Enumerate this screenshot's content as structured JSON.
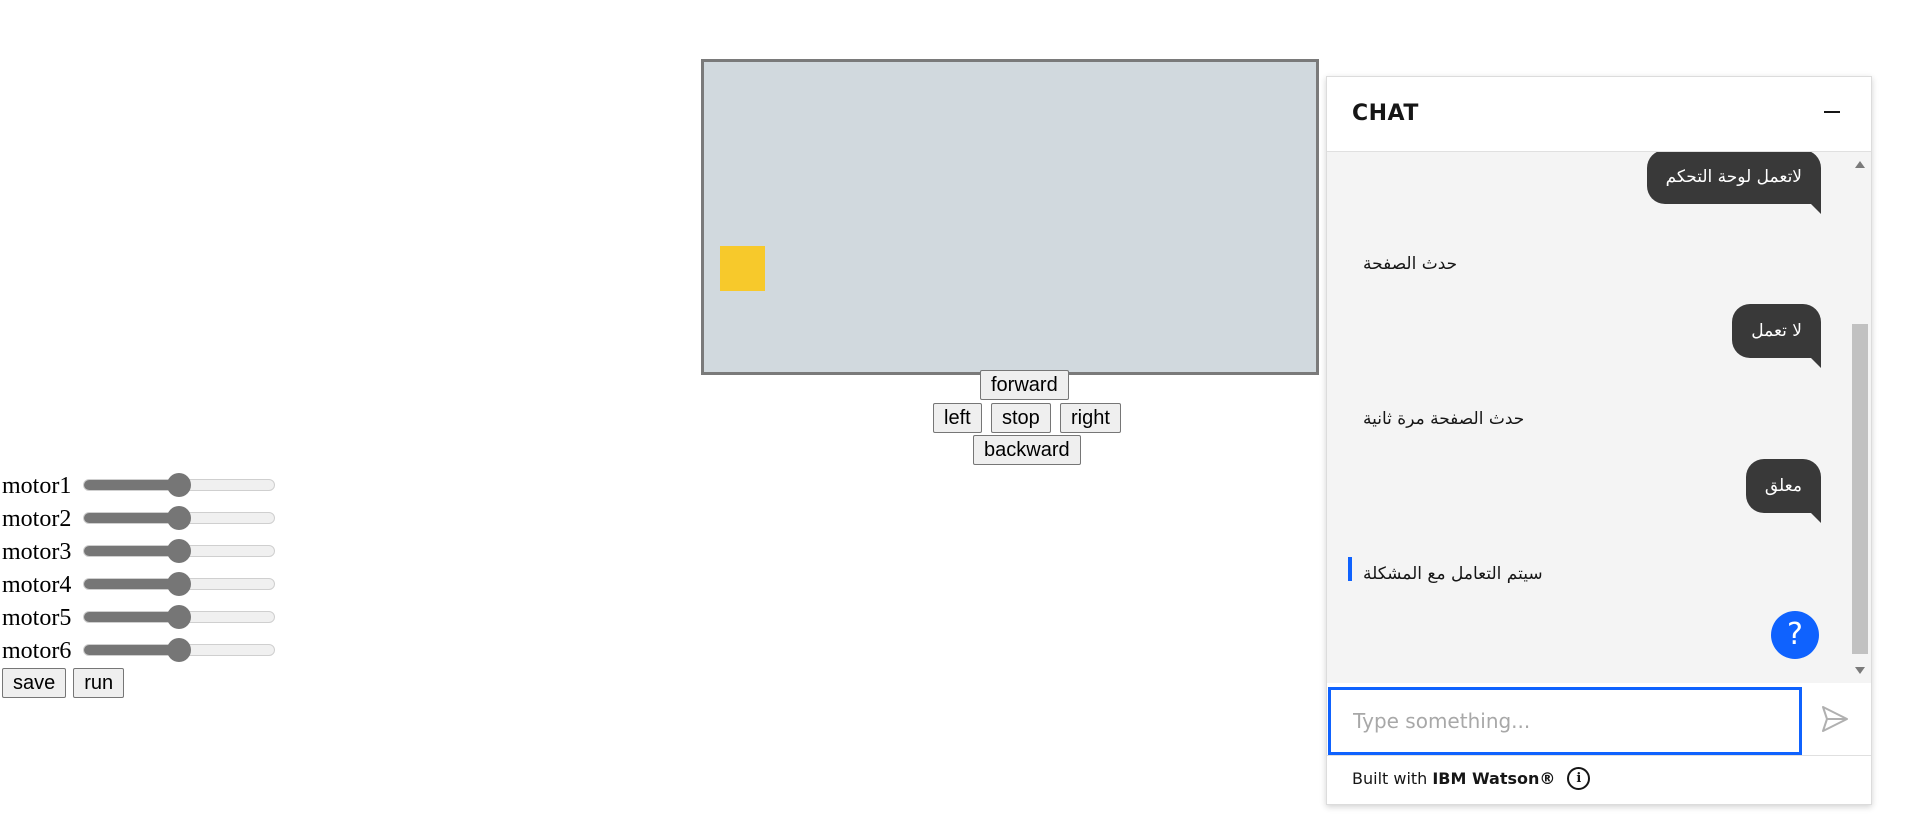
{
  "motors": {
    "items": [
      {
        "label": "motor1",
        "value": 0.5
      },
      {
        "label": "motor2",
        "value": 0.5
      },
      {
        "label": "motor3",
        "value": 0.5
      },
      {
        "label": "motor4",
        "value": 0.5
      },
      {
        "label": "motor5",
        "value": 0.5
      },
      {
        "label": "motor6",
        "value": 0.5
      }
    ],
    "save_label": "save",
    "run_label": "run"
  },
  "canvas": {
    "background": "#d1d9de",
    "robot_color": "#f7c92b"
  },
  "controls": {
    "forward": "forward",
    "left": "left",
    "stop": "stop",
    "right": "right",
    "backward": "backward"
  },
  "chat": {
    "title": "CHAT",
    "messages": [
      {
        "from": "user",
        "text": "لاتعمل لوحة التحكم"
      },
      {
        "from": "bot",
        "text": "حدث الصفحة"
      },
      {
        "from": "user",
        "text": "لا تعمل"
      },
      {
        "from": "bot",
        "text": "حدث الصفحة مرة ثانية"
      },
      {
        "from": "user",
        "text": "معلق"
      },
      {
        "from": "bot",
        "text": "سيتم التعامل مع المشكلة"
      }
    ],
    "help_label": "?",
    "input_placeholder": "Type something...",
    "footer_prefix": "Built with",
    "footer_brand": "IBM Watson®",
    "info_label": "i",
    "accent_color": "#0f62fe"
  }
}
